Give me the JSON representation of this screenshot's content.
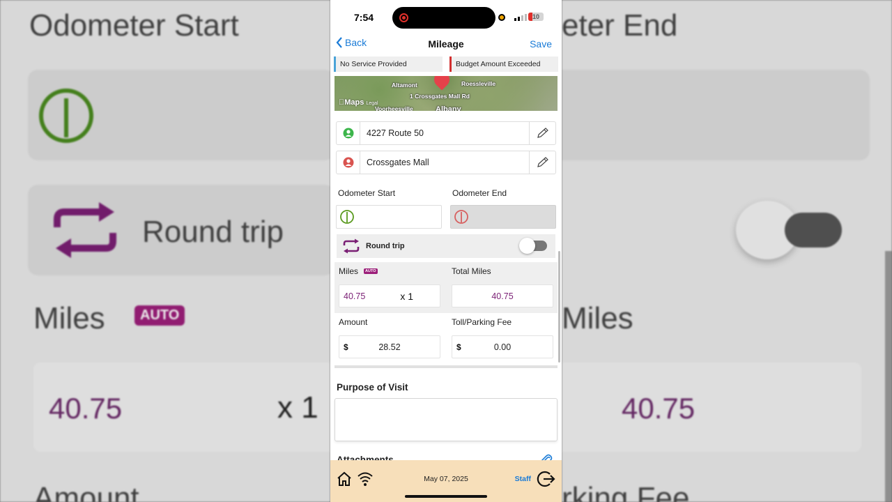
{
  "status_bar": {
    "time": "7:54",
    "battery": "10"
  },
  "nav": {
    "back_label": "Back",
    "title": "Mileage",
    "save_label": "Save"
  },
  "legend": {
    "no_service": "No Service Provided",
    "budget_exceeded": "Budget Amount Exceeded",
    "no_service_color": "#4aa3d8",
    "budget_color": "#d32f2f"
  },
  "map": {
    "labels": [
      "Altamont",
      "Roessleville",
      "1 Crossgates Mall Rd",
      "Voorheesville",
      "Albany"
    ],
    "logo": "Maps",
    "legal": "Legal"
  },
  "route": {
    "start": "4227 Route 50",
    "end": "Crossgates Mall"
  },
  "odometer": {
    "start_label": "Odometer Start",
    "end_label": "Odometer End"
  },
  "round_trip": {
    "label": "Round trip",
    "enabled": false
  },
  "miles": {
    "label": "Miles",
    "auto_badge": "AUTO",
    "value": "40.75",
    "multiplier": "x 1",
    "total_label": "Total Miles",
    "total_value": "40.75"
  },
  "amount": {
    "label": "Amount",
    "currency": "$",
    "value": "28.52",
    "toll_label": "Toll/Parking Fee",
    "toll_currency": "$",
    "toll_value": "0.00"
  },
  "purpose": {
    "title": "Purpose of Visit"
  },
  "attachments": {
    "title": "Attachments"
  },
  "bottom_bar": {
    "date": "May 07, 2025",
    "user": "Staff"
  },
  "background": {
    "odo_start": "Odometer Start",
    "odo_end": "eter End",
    "round_trip": "Round trip",
    "miles_left": "Miles",
    "auto": "AUTO",
    "miles_right": "Miles",
    "value_left": "40.75",
    "mult": "x 1",
    "value_right": "40.75",
    "amount": "Amount",
    "fee": "rking Fee"
  },
  "colors": {
    "accent": "#1a7bd7",
    "purple": "#7a1f74",
    "bottom_bar": "#f7dfba"
  }
}
